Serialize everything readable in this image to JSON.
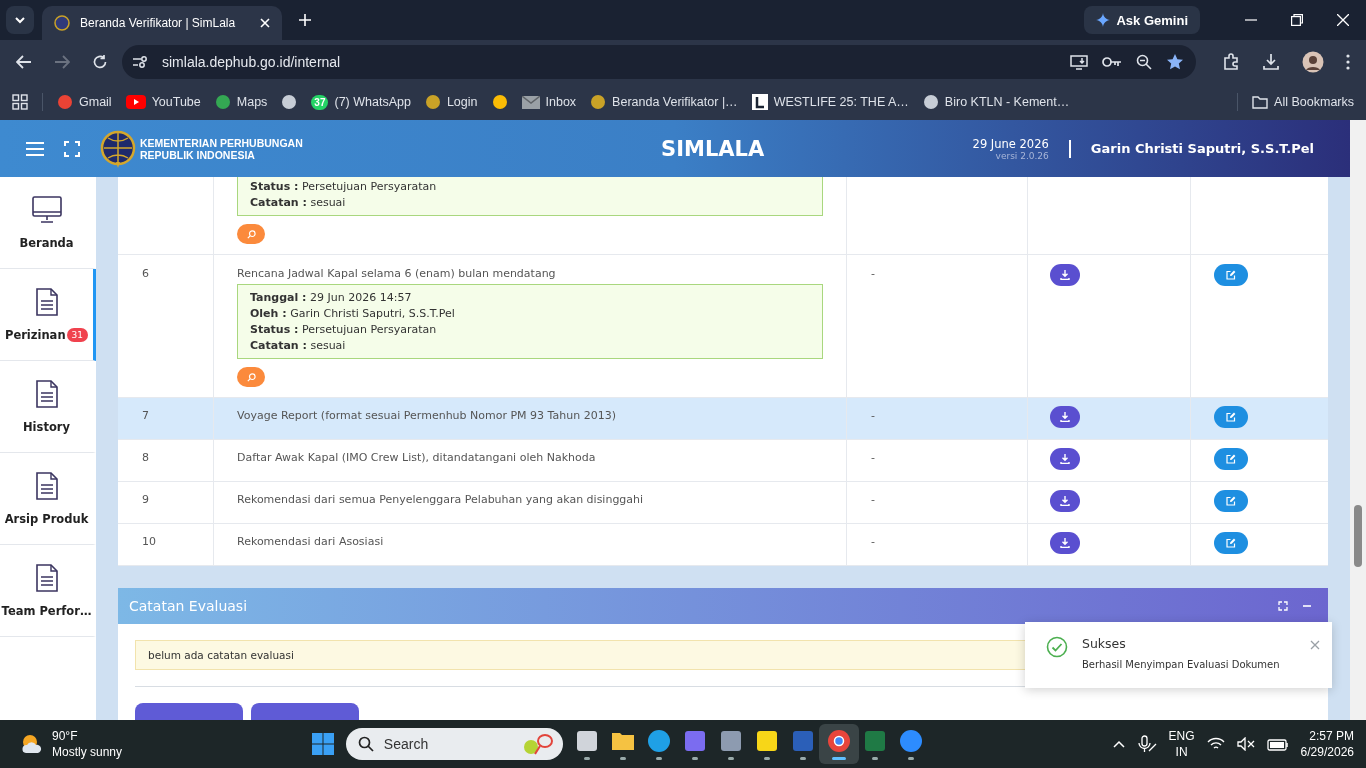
{
  "browser": {
    "tabs": [
      {
        "title": "Beranda Verifikator | SimLala",
        "selected": true
      }
    ],
    "ask_gemini": "Ask Gemini",
    "address": "simlala.dephub.go.id/internal",
    "bookmarks": [
      {
        "label": "Gmail",
        "kind": "gmail"
      },
      {
        "label": "YouTube",
        "kind": "youtube"
      },
      {
        "label": "Maps",
        "kind": "maps"
      },
      {
        "kind": "globe"
      },
      {
        "label": "(7) WhatsApp",
        "kind": "whatsapp",
        "badge": "37"
      },
      {
        "label": "Login",
        "kind": "emblem"
      },
      {
        "kind": "pinwheel"
      },
      {
        "label": "Inbox",
        "kind": "mail"
      },
      {
        "label": "Beranda Verifikator |…",
        "kind": "emblem"
      },
      {
        "label": "WESTLIFE 25: THE A…",
        "kind": "square"
      },
      {
        "label": "Biro KTLN - Kement…",
        "kind": "globe"
      }
    ],
    "all_bookmarks": "All Bookmarks"
  },
  "header": {
    "org": [
      "KEMENTERIAN PERHUBUNGAN",
      "REPUBLIK INDONESIA"
    ],
    "title": "SIMLALA",
    "date": "29 June 2026",
    "version": "versi 2.0.26",
    "user": "Garin Christi Saputri, S.S.T.Pel"
  },
  "sidebar": [
    {
      "label": "Beranda",
      "kind": "monitor",
      "selected": false
    },
    {
      "label": "Perizinan",
      "kind": "document",
      "selected": true,
      "badge": "31"
    },
    {
      "label": "History",
      "kind": "document",
      "selected": false
    },
    {
      "label": "Arsip Produk",
      "kind": "document",
      "selected": false
    },
    {
      "label": "Team Perfor…",
      "kind": "document",
      "selected": false
    }
  ],
  "documents": [
    {
      "notes": [
        {
          "label": "Status :",
          "value": "Persetujuan Persyaratan"
        },
        {
          "label": "Catatan :",
          "value": "sesuai"
        }
      ],
      "reviewed": true,
      "actions": false,
      "selected": false
    },
    {
      "number": "6",
      "document": "Rencana Jadwal Kapal selama 6 (enam) bulan mendatang",
      "notes": [
        {
          "label": "Tanggal :",
          "value": "29 Jun 2026 14:57"
        },
        {
          "label": "Oleh :",
          "value": "Garin Christi Saputri, S.S.T.Pel"
        },
        {
          "label": "Status :",
          "value": "Persetujuan Persyaratan"
        },
        {
          "label": "Catatan :",
          "value": "sesuai"
        }
      ],
      "reviewed": true,
      "keterangan": "-",
      "actions": true,
      "selected": false
    },
    {
      "number": "7",
      "document": "Voyage Report (format sesuai Permenhub Nomor PM 93 Tahun 2013)",
      "reviewed": false,
      "keterangan": "-",
      "actions": true,
      "selected": true
    },
    {
      "number": "8",
      "document": "Daftar Awak Kapal (IMO Crew List), ditandatangani oleh Nakhoda",
      "reviewed": false,
      "keterangan": "-",
      "actions": true,
      "selected": false
    },
    {
      "number": "9",
      "document": "Rekomendasi dari semua Penyelenggara Pelabuhan yang akan disinggahi",
      "reviewed": false,
      "keterangan": "-",
      "actions": true,
      "selected": false
    },
    {
      "number": "10",
      "document": "Rekomendasi dari Asosiasi",
      "reviewed": false,
      "keterangan": "-",
      "actions": true,
      "selected": false
    }
  ],
  "evaluation": {
    "title": "Catatan Evaluasi",
    "note": "belum ada catatan evaluasi"
  },
  "toast": {
    "title": "Sukses",
    "message": "Berhasil Menyimpan Evaluasi Dokumen"
  },
  "taskbar": {
    "temperature": "90°F",
    "weather": "Mostly sunny",
    "search": "Search",
    "apps": [
      {
        "kind": "taskview",
        "selected": false
      },
      {
        "kind": "files",
        "selected": false
      },
      {
        "kind": "edge",
        "selected": false
      },
      {
        "kind": "copilot",
        "selected": false
      },
      {
        "kind": "camera",
        "selected": false
      },
      {
        "kind": "notes",
        "selected": false
      },
      {
        "kind": "word",
        "selected": false
      },
      {
        "kind": "chrome",
        "selected": true
      },
      {
        "kind": "excel",
        "selected": false
      },
      {
        "kind": "zoom",
        "selected": false
      }
    ],
    "language": [
      "ENG",
      "IN"
    ],
    "time": "2:57 PM",
    "date": "6/29/2026"
  }
}
